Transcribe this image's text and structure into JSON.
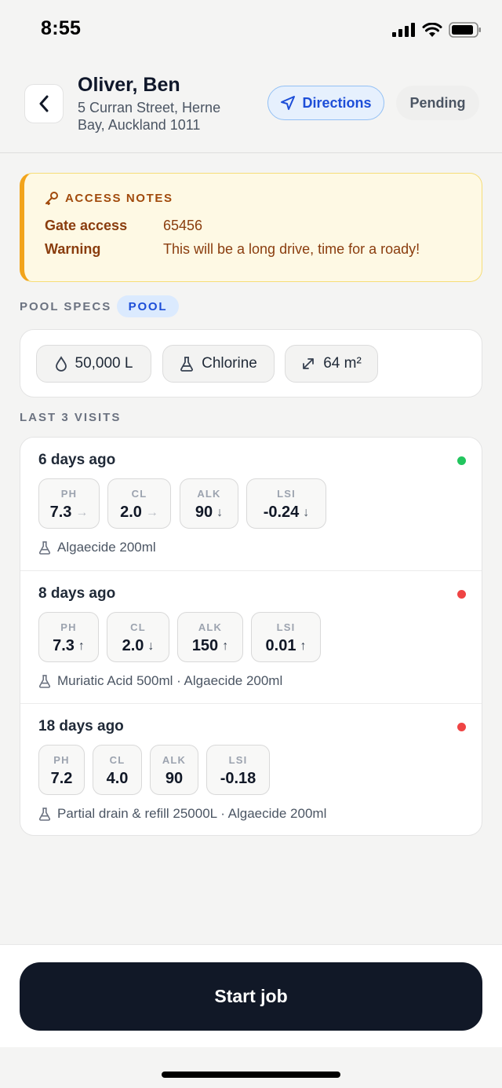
{
  "status_bar": {
    "time": "8:55"
  },
  "header": {
    "client_name": "Oliver, Ben",
    "address": "5 Curran Street, Herne Bay, Auckland 1011",
    "directions_label": "Directions",
    "status_label": "Pending"
  },
  "access_notes": {
    "title": "ACCESS NOTES",
    "rows": [
      {
        "label": "Gate access",
        "value": "65456"
      },
      {
        "label": "Warning",
        "value": "This will be a long drive, time for a roady!"
      }
    ]
  },
  "pool_specs": {
    "label": "POOL SPECS",
    "badge": "POOL",
    "chips": [
      {
        "icon": "water-drop-icon",
        "text": "50,000 L"
      },
      {
        "icon": "flask-icon",
        "text": "Chlorine"
      },
      {
        "icon": "expand-arrows-icon",
        "text": "64 m²"
      }
    ]
  },
  "visits": {
    "label": "LAST 3 VISITS",
    "items": [
      {
        "date": "6 days ago",
        "status_color": "#22c55e",
        "metrics": [
          {
            "label": "PH",
            "value": "7.3",
            "trend": "→"
          },
          {
            "label": "CL",
            "value": "2.0",
            "trend": "→"
          },
          {
            "label": "ALK",
            "value": "90",
            "trend": "↓"
          },
          {
            "label": "LSI",
            "value": "-0.24",
            "trend": "↓"
          }
        ],
        "notes": "Algaecide 200ml"
      },
      {
        "date": "8 days ago",
        "status_color": "#ef4444",
        "metrics": [
          {
            "label": "PH",
            "value": "7.3",
            "trend": "↑"
          },
          {
            "label": "CL",
            "value": "2.0",
            "trend": "↓"
          },
          {
            "label": "ALK",
            "value": "150",
            "trend": "↑"
          },
          {
            "label": "LSI",
            "value": "0.01",
            "trend": "↑"
          }
        ],
        "notes": "Muriatic Acid 500ml · Algaecide 200ml"
      },
      {
        "date": "18 days ago",
        "status_color": "#ef4444",
        "metrics": [
          {
            "label": "PH",
            "value": "7.2",
            "trend": ""
          },
          {
            "label": "CL",
            "value": "4.0",
            "trend": ""
          },
          {
            "label": "ALK",
            "value": "90",
            "trend": ""
          },
          {
            "label": "LSI",
            "value": "-0.18",
            "trend": ""
          }
        ],
        "notes": "Partial drain & refill 25000L · Algaecide 200ml"
      }
    ]
  },
  "footer": {
    "start_label": "Start job"
  }
}
